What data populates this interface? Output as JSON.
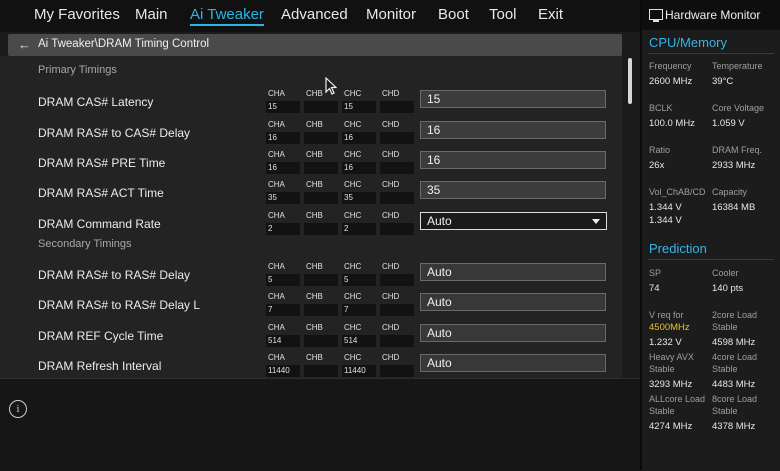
{
  "nav": {
    "tabs": [
      "My Favorites",
      "Main",
      "Ai Tweaker",
      "Advanced",
      "Monitor",
      "Boot",
      "Tool",
      "Exit"
    ],
    "active": "Ai Tweaker"
  },
  "breadcrumb": {
    "path": "Ai Tweaker\\DRAM Timing Control",
    "back_icon": "arrow-left-icon"
  },
  "sections": {
    "primary": "Primary Timings",
    "secondary": "Secondary Timings"
  },
  "channel_names": [
    "CHA",
    "CHB",
    "CHC",
    "CHD"
  ],
  "rows": [
    {
      "label": "DRAM CAS# Latency",
      "channels": [
        "15",
        "",
        "15",
        ""
      ],
      "value": "15"
    },
    {
      "label": "DRAM RAS# to CAS# Delay",
      "channels": [
        "16",
        "",
        "16",
        ""
      ],
      "value": "16"
    },
    {
      "label": "DRAM RAS# PRE Time",
      "channels": [
        "16",
        "",
        "16",
        ""
      ],
      "value": "16"
    },
    {
      "label": "DRAM RAS# ACT Time",
      "channels": [
        "35",
        "",
        "35",
        ""
      ],
      "value": "35"
    },
    {
      "label": "DRAM Command Rate",
      "channels": [
        "2",
        "",
        "2",
        ""
      ],
      "value": "Auto",
      "dropdown": true
    },
    {
      "label": "DRAM RAS# to RAS# Delay",
      "channels": [
        "5",
        "",
        "5",
        ""
      ],
      "value": "Auto"
    },
    {
      "label": "DRAM RAS# to RAS# Delay L",
      "channels": [
        "7",
        "",
        "7",
        ""
      ],
      "value": "Auto"
    },
    {
      "label": "DRAM REF Cycle Time",
      "channels": [
        "514",
        "",
        "514",
        ""
      ],
      "value": "Auto"
    },
    {
      "label": "DRAM Refresh Interval",
      "channels": [
        "11440",
        "",
        "11440",
        ""
      ],
      "value": "Auto"
    }
  ],
  "hw_monitor": {
    "title": "Hardware Monitor",
    "cpu_memory": {
      "title": "CPU/Memory",
      "frequency_label": "Frequency",
      "frequency": "2600 MHz",
      "temperature_label": "Temperature",
      "temperature": "39°C",
      "bclk_label": "BCLK",
      "bclk": "100.0 MHz",
      "core_voltage_label": "Core Voltage",
      "core_voltage": "1.059 V",
      "ratio_label": "Ratio",
      "ratio": "26x",
      "dram_freq_label": "DRAM Freq.",
      "dram_freq": "2933 MHz",
      "vol_label": "Vol_ChAB/CD",
      "vol_ab": "1.344 V",
      "vol_cd": "1.344 V",
      "capacity_label": "Capacity",
      "capacity": "16384 MB"
    },
    "prediction": {
      "title": "Prediction",
      "sp_label": "SP",
      "sp": "74",
      "cooler_label": "Cooler",
      "cooler": "140 pts",
      "vreq_label": "V req for",
      "vreq_freq": "4500MHz",
      "vreq": "1.232 V",
      "core2_label": "2core Load",
      "core2_sub": "Stable",
      "core2": "4598 MHz",
      "avx_label": "Heavy AVX",
      "avx_sub": "Stable",
      "avx": "3293 MHz",
      "core4_label": "4core Load",
      "core4_sub": "Stable",
      "core4": "4483 MHz",
      "allcore_label": "ALLcore Load",
      "allcore_sub": "Stable",
      "allcore": "4274 MHz",
      "core8_label": "8core Load",
      "core8_sub": "Stable",
      "core8": "4378 MHz"
    }
  },
  "colors": {
    "accent": "#29b6e6",
    "highlight": "#e8c22e"
  }
}
